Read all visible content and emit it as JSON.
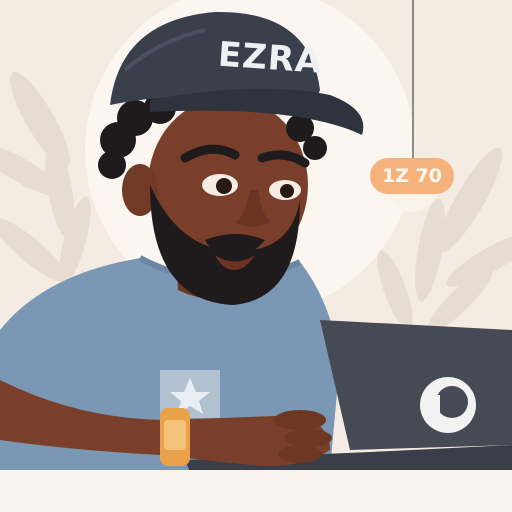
{
  "cap": {
    "text": "EZRA"
  },
  "badge": {
    "text": "1Z 70"
  },
  "colors": {
    "background": "#f4ece3",
    "cap": "#3a3f4c",
    "shirt": "#7a98b4",
    "skin": "#7a3f2a",
    "beard": "#1f1a1b",
    "laptop": "#454a55",
    "badge": "#f6b27c",
    "watch": "#e9a24a"
  },
  "icons": [
    "leaf-shadow",
    "laptop-logo-icon",
    "wristwatch",
    "pendant-lamp"
  ]
}
